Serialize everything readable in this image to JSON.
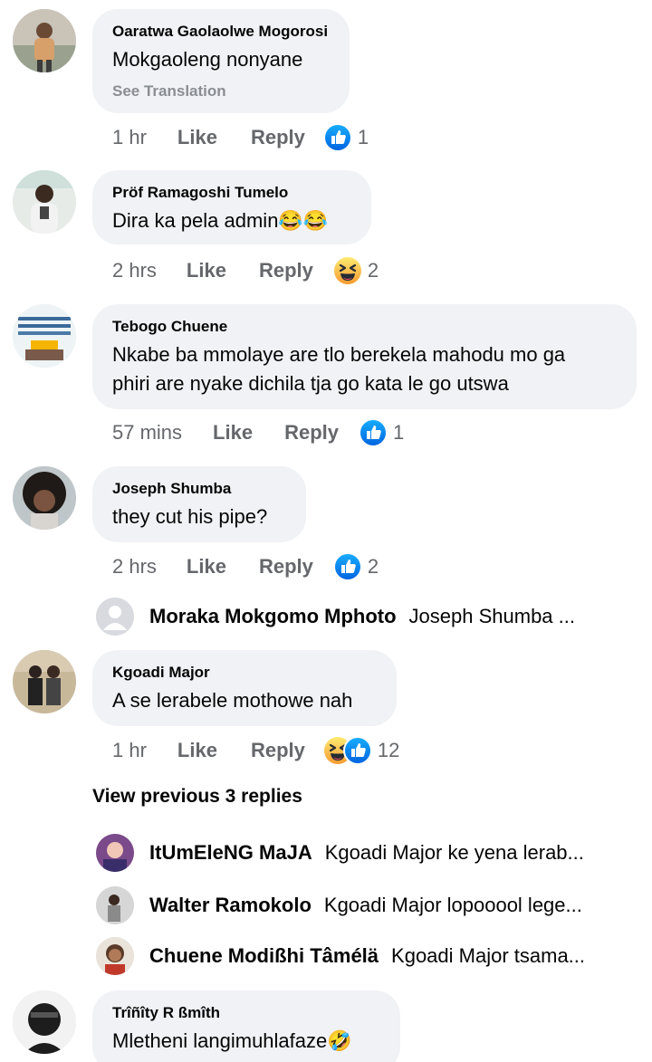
{
  "comments": [
    {
      "author": "Oaratwa Gaolaolwe Mogorosi",
      "text": "Mokgaoleng nonyane",
      "see_translation": "See Translation",
      "time": "1 hr",
      "like": "Like",
      "reply": "Reply",
      "reactions": [
        "like-icon"
      ],
      "reaction_count": "1"
    },
    {
      "author": "Pröf Ramagoshi Tumelo",
      "text": "Dira ka pela admin😂😂",
      "time": "2 hrs",
      "like": "Like",
      "reply": "Reply",
      "reactions": [
        "haha-icon"
      ],
      "reaction_count": "2"
    },
    {
      "author": "Tebogo Chuene",
      "text_line1": "Nkabe ba mmolaye  are tlo berekela mahodu mo  ga",
      "text_line2": "phiri are nyake dichila tja go kata le go utswa",
      "time": "57 mins",
      "like": "Like",
      "reply": "Reply",
      "reactions": [
        "like-icon"
      ],
      "reaction_count": "1"
    },
    {
      "author": "Joseph Shumba",
      "text": "they cut his pipe?",
      "time": "2 hrs",
      "like": "Like",
      "reply": "Reply",
      "reactions": [
        "like-icon"
      ],
      "reaction_count": "2",
      "reply_preview": {
        "name": "Moraka Mokgomo Mphoto",
        "text": "Joseph Shumba ..."
      }
    },
    {
      "author": "Kgoadi Major",
      "text": "A se lerabele mothowe nah",
      "time": "1 hr",
      "like": "Like",
      "reply": "Reply",
      "reactions": [
        "haha-icon",
        "like-icon"
      ],
      "reaction_count": "12",
      "view_previous": "View previous 3 replies",
      "replies": [
        {
          "name": "ItUmEleNG MaJA",
          "text": "Kgoadi Major ke yena lerab..."
        },
        {
          "name": "Walter Ramokolo",
          "text": "Kgoadi Major lopooool lege..."
        },
        {
          "name": "Chuene Modißhi Tâmélä",
          "text": "Kgoadi Major tsama..."
        }
      ]
    },
    {
      "author": "Trîñîty R ßmîth",
      "text": "Mletheni langimuhlafaze🤣"
    }
  ],
  "colors": {
    "bubble": "#f0f2f5",
    "meta_text": "#65676b",
    "like_blue": "#1877f2",
    "haha_yellow": "#f7b125"
  }
}
